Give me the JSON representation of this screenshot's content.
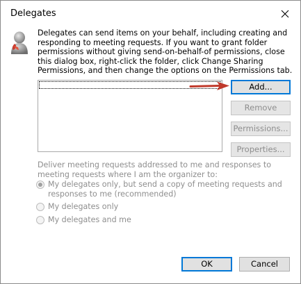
{
  "window": {
    "title": "Delegates"
  },
  "info": {
    "text": "Delegates can send items on your behalf, including creating and responding to meeting requests. If you want to grant folder permissions without giving send-on-behalf-of permissions, close this dialog box, right-click the folder, click Change Sharing Permissions, and then change the options on the Permissions tab."
  },
  "delegates": {
    "items": []
  },
  "buttons": {
    "add": "Add...",
    "remove": "Remove",
    "permissions": "Permissions...",
    "properties": "Properties...",
    "ok": "OK",
    "cancel": "Cancel"
  },
  "meeting_requests": {
    "label": "Deliver meeting requests addressed to me and responses to meeting requests where I am the organizer to:",
    "options": [
      {
        "label": "My delegates only, but send a copy of meeting requests and responses to me (recommended)",
        "selected": true
      },
      {
        "label": "My delegates only",
        "selected": false
      },
      {
        "label": "My delegates and me",
        "selected": false
      }
    ]
  },
  "colors": {
    "annotation_arrow": "#c0392b",
    "default_button_border": "#0078d7",
    "disabled_text": "#8e8e8e"
  },
  "icons": {
    "header": "person-icon",
    "close": "close-icon",
    "annotation": "red-arrow-icon"
  }
}
